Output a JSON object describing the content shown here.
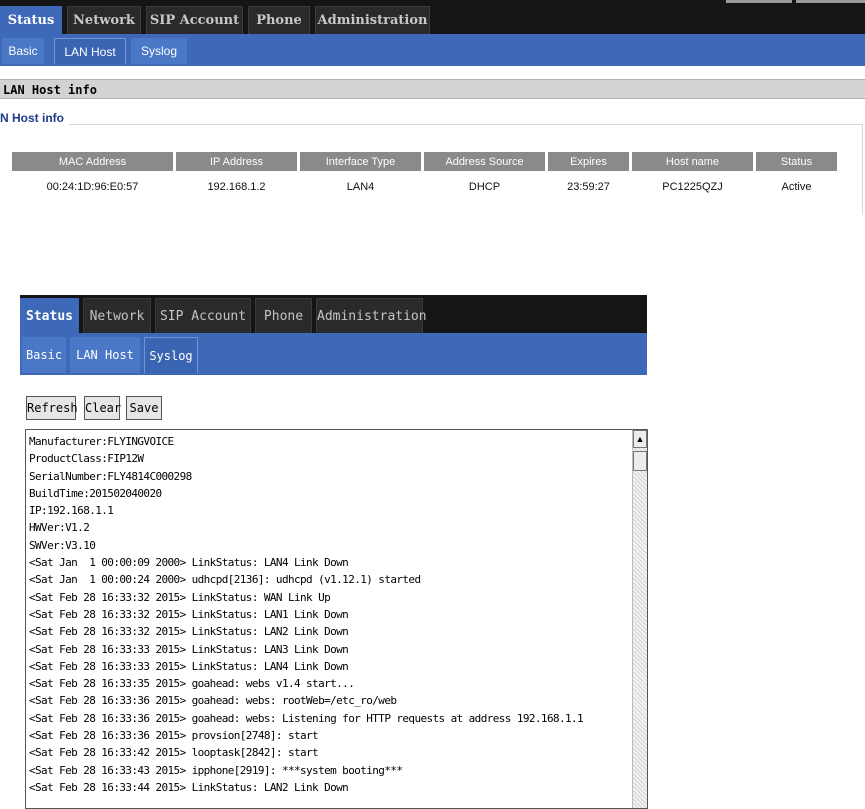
{
  "top_panel": {
    "tabs": [
      "Status",
      "Network",
      "SIP Account",
      "Phone",
      "Administration"
    ],
    "subtabs": [
      "Basic",
      "LAN Host",
      "Syslog"
    ],
    "section_title": "LAN Host info",
    "fieldset_legend": "N Host info",
    "table": {
      "headers": [
        "MAC Address",
        "IP Address",
        "Interface Type",
        "Address Source",
        "Expires",
        "Host name",
        "Status"
      ],
      "rows": [
        [
          "00:24:1D:96:E0:57",
          "192.168.1.2",
          "LAN4",
          "DHCP",
          "23:59:27",
          "PC1225QZJ",
          "Active"
        ]
      ]
    }
  },
  "syslog_panel": {
    "tabs": [
      "Status",
      "Network",
      "SIP Account",
      "Phone",
      "Administration"
    ],
    "subtabs": [
      "Basic",
      "LAN Host",
      "Syslog"
    ],
    "buttons": {
      "refresh": "Refresh",
      "clear": "Clear",
      "save": "Save"
    },
    "scroll_up_glyph": "▲",
    "log_lines": [
      "Manufacturer:FLYINGVOICE",
      "ProductClass:FIP12W",
      "SerialNumber:FLY4814C000298",
      "BuildTime:201502040020",
      "IP:192.168.1.1",
      "HWVer:V1.2",
      "SWVer:V3.10",
      "<Sat Jan  1 00:00:09 2000> LinkStatus: LAN4 Link Down",
      "<Sat Jan  1 00:00:24 2000> udhcpd[2136]: udhcpd (v1.12.1) started",
      "<Sat Feb 28 16:33:32 2015> LinkStatus: WAN Link Up",
      "<Sat Feb 28 16:33:32 2015> LinkStatus: LAN1 Link Down",
      "<Sat Feb 28 16:33:32 2015> LinkStatus: LAN2 Link Down",
      "<Sat Feb 28 16:33:33 2015> LinkStatus: LAN3 Link Down",
      "<Sat Feb 28 16:33:33 2015> LinkStatus: LAN4 Link Down",
      "<Sat Feb 28 16:33:35 2015> goahead: webs v1.4 start...",
      "<Sat Feb 28 16:33:36 2015> goahead: webs: rootWeb=/etc_ro/web",
      "<Sat Feb 28 16:33:36 2015> goahead: webs: Listening for HTTP requests at address 192.168.1.1",
      "<Sat Feb 28 16:33:36 2015> provsion[2748]: start",
      "<Sat Feb 28 16:33:42 2015> looptask[2842]: start",
      "<Sat Feb 28 16:33:43 2015> ipphone[2919]: ***system booting***",
      "<Sat Feb 28 16:33:44 2015> LinkStatus: LAN2 Link Down"
    ]
  }
}
